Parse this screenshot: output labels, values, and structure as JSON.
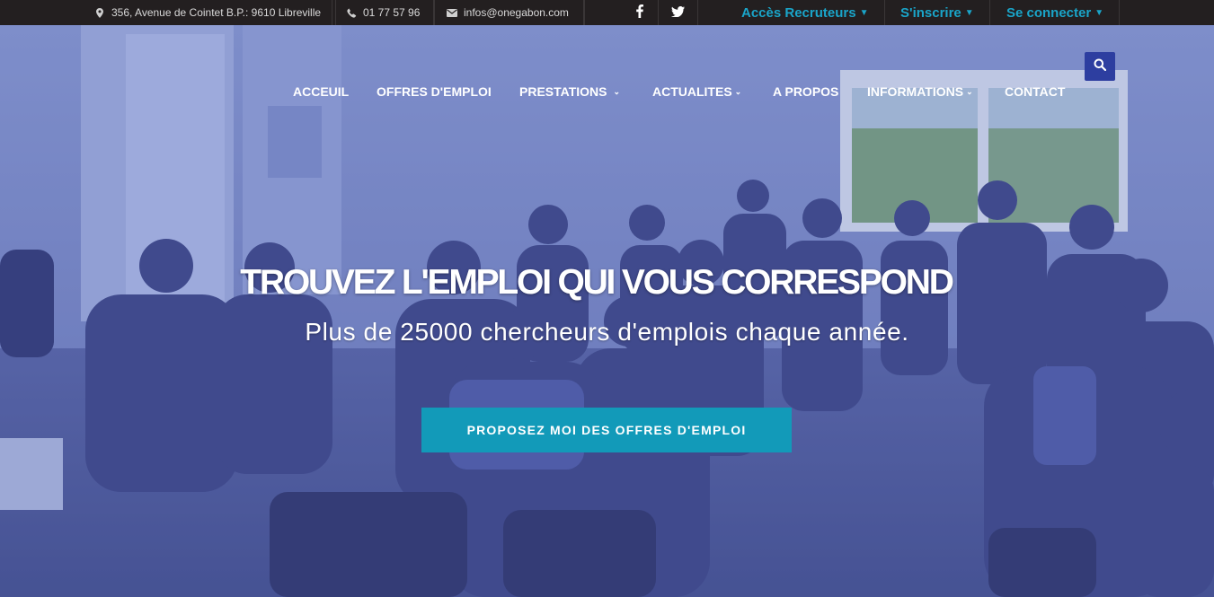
{
  "topbar": {
    "address": "356, Avenue de Cointet B.P.: 9610 Libreville",
    "phone": "01 77 57 96",
    "email": "infos@onegabon.com",
    "social": {
      "facebook_icon": "facebook-icon",
      "twitter_icon": "twitter-icon"
    },
    "account_links": [
      {
        "label": "Accès Recruteurs"
      },
      {
        "label": "S'inscrire"
      },
      {
        "label": "Se connecter"
      }
    ],
    "accent_color": "#1aa5c9"
  },
  "nav": {
    "items": [
      {
        "label": "ACCEUIL"
      },
      {
        "label": "OFFRES D'EMPLOI"
      },
      {
        "label": "PRESTATIONS"
      },
      {
        "label": "ACTUALITES"
      },
      {
        "label": "A PROPOS"
      },
      {
        "label": "INFORMATIONS"
      },
      {
        "label": "CONTACT"
      }
    ],
    "search_icon": "search-icon"
  },
  "hero": {
    "title": "TROUVEZ L'EMPLOI QUI VOUS CORRESPOND",
    "subtitle": "Plus de 25000 chercheurs d'emplois chaque année.",
    "cta_label": "PROPOSEZ MOI DES OFFRES D'EMPLOI",
    "cta_color": "#129ab9",
    "overlay_color": "#4b5aa8"
  }
}
